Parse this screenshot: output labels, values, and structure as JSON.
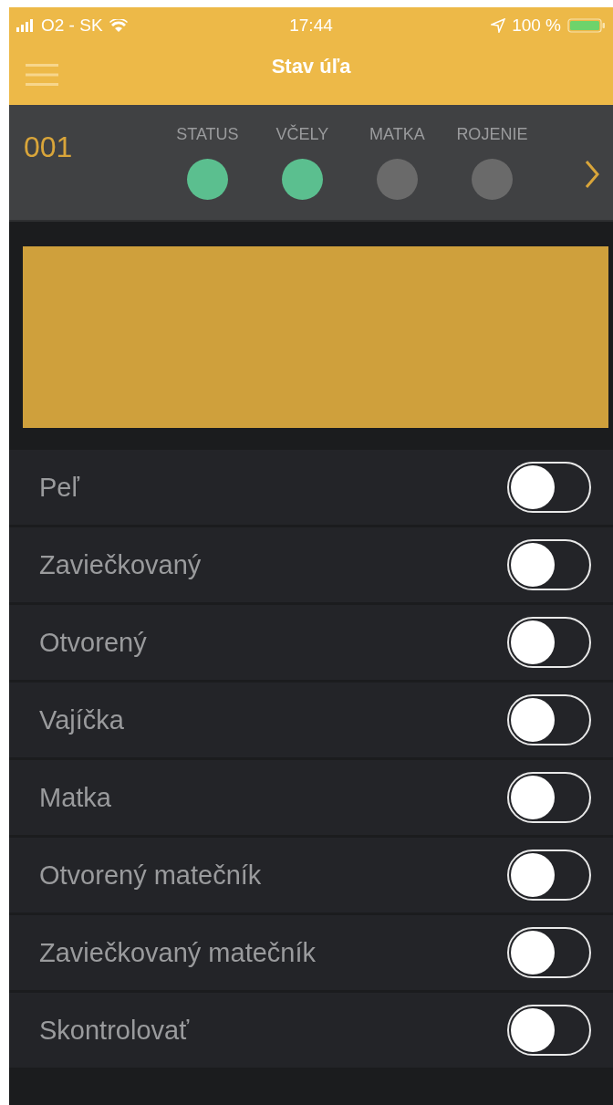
{
  "status_bar": {
    "carrier": "O2 - SK",
    "time": "17:44",
    "battery": "100 %"
  },
  "nav_bar": {
    "title": "Stav úľa"
  },
  "hive": {
    "number": "001",
    "indicators": [
      {
        "label": "STATUS",
        "color": "#5bbf8f"
      },
      {
        "label": "VČELY",
        "color": "#5bbf8f"
      },
      {
        "label": "MATKA",
        "color": "#6a6a6a"
      },
      {
        "label": "ROJENIE",
        "color": "#6a6a6a"
      }
    ]
  },
  "switches": [
    {
      "label": "Peľ",
      "on": false
    },
    {
      "label": "Zaviečkovaný",
      "on": false
    },
    {
      "label": "Otvorený",
      "on": false
    },
    {
      "label": "Vajíčka",
      "on": false
    },
    {
      "label": "Matka",
      "on": false
    },
    {
      "label": "Otvorený matečník",
      "on": false
    },
    {
      "label": "Zaviečkovaný matečník",
      "on": false
    },
    {
      "label": "Skontrolovať",
      "on": false
    }
  ]
}
